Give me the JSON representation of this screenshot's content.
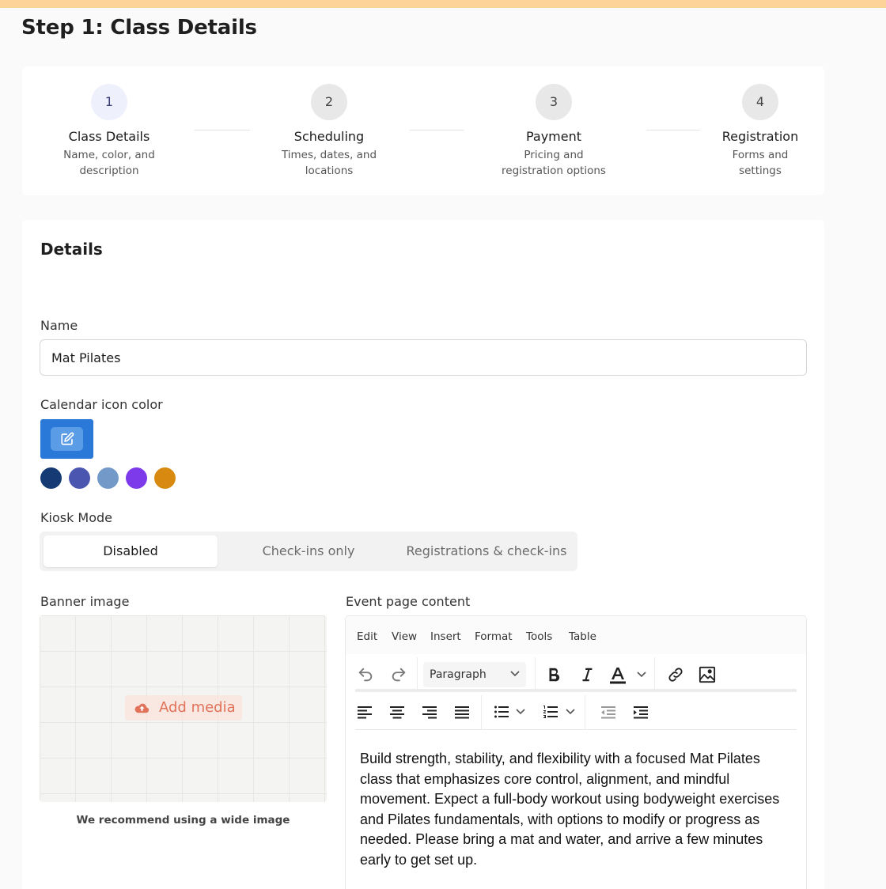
{
  "page": {
    "title": "Step 1: Class Details"
  },
  "stepper": {
    "steps": [
      {
        "number": "1",
        "title": "Class Details",
        "desc": "Name, color, and description"
      },
      {
        "number": "2",
        "title": "Scheduling",
        "desc": "Times, dates, and locations"
      },
      {
        "number": "3",
        "title": "Payment",
        "desc": "Pricing and registration options"
      },
      {
        "number": "4",
        "title": "Registration",
        "desc": "Forms and settings"
      }
    ],
    "active_step": 1
  },
  "details": {
    "section_title": "Details",
    "name_label": "Name",
    "name_value": "Mat Pilates",
    "color_label": "Calendar icon color",
    "color_selected": "#2a79d9",
    "color_options": [
      "#163b74",
      "#4a56b0",
      "#7399c9",
      "#7c3aeb",
      "#d8890f"
    ],
    "kiosk_label": "Kiosk Mode",
    "kiosk_options": [
      "Disabled",
      "Check-ins only",
      "Registrations & check-ins"
    ],
    "kiosk_selected": "Disabled",
    "banner_label": "Banner image",
    "add_media_label": "Add media",
    "banner_hint": "We recommend using a wide image",
    "content_label": "Event page content"
  },
  "editor": {
    "menu": [
      "Edit",
      "View",
      "Insert",
      "Format",
      "Tools",
      "Table"
    ],
    "block_format": "Paragraph",
    "content": "Build strength, stability, and flexibility with a focused Mat Pilates class that emphasizes core control, alignment, and mindful movement. Expect a full-body workout using bodyweight exercises and Pilates fundamentals, with options to modify or progress as needed. Please bring a mat and water, and arrive a few minutes early to get set up."
  },
  "icons": {
    "edit": "pencil-square-icon",
    "upload": "cloud-upload-icon",
    "undo": "undo-icon",
    "redo": "redo-icon",
    "bold": "bold-icon",
    "italic": "italic-icon",
    "text_color": "text-color-icon",
    "link": "link-icon",
    "image": "image-icon",
    "align_left": "align-left-icon",
    "align_center": "align-center-icon",
    "align_right": "align-right-icon",
    "align_justify": "align-justify-icon",
    "bullet_list": "bullet-list-icon",
    "numbered_list": "numbered-list-icon",
    "outdent": "outdent-icon",
    "indent": "indent-icon"
  }
}
